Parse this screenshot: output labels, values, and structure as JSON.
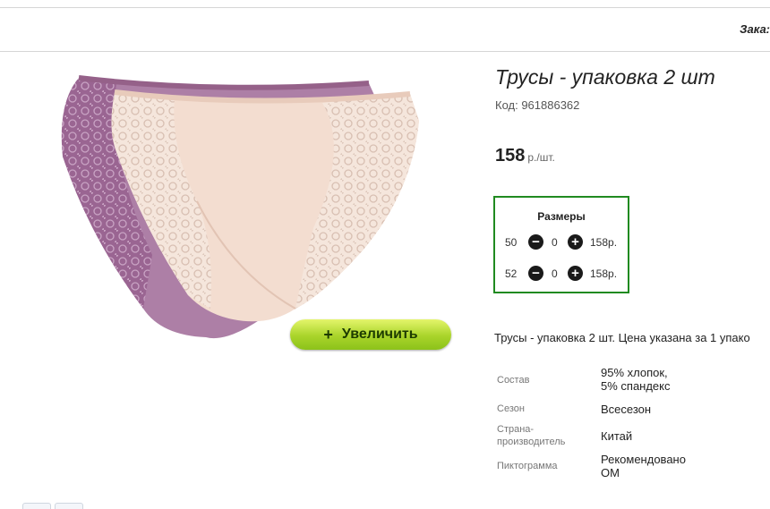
{
  "header": {
    "order_label": "Зака:"
  },
  "product": {
    "title": "Трусы - упаковка 2 шт",
    "code": "Код: 961886362",
    "price": "158",
    "price_unit": "р./шт.",
    "image_alt": "Трусы - упаковка 2 шт",
    "zoom_button_label": "Увеличить",
    "sizes": {
      "title": "Размеры",
      "rows": [
        {
          "size": "50",
          "quantity": "0",
          "price": "158р."
        },
        {
          "size": "52",
          "quantity": "0",
          "price": "158р."
        }
      ]
    },
    "description": "Трусы - упаковка 2 шт. Цена указана за 1 упако",
    "attributes": [
      {
        "label": "Состав",
        "value": "95% хлопок,\n5% спандекс"
      },
      {
        "label": "Сезон",
        "value": "Всесезон"
      },
      {
        "label": "Страна-\nпроизводитель",
        "value": "Китай"
      },
      {
        "label": "Пиктограмма",
        "value": "Рекомендовано\nОМ"
      }
    ]
  },
  "colors": {
    "sizes_border": "#208a20",
    "zoom_button": "#a9d42a",
    "lace_purple": "#a5729e",
    "fabric_beige": "#f3ddd0"
  },
  "icons": {
    "minus": "minus-circle-icon",
    "plus": "plus-circle-icon",
    "zoom": "plus-icon"
  }
}
